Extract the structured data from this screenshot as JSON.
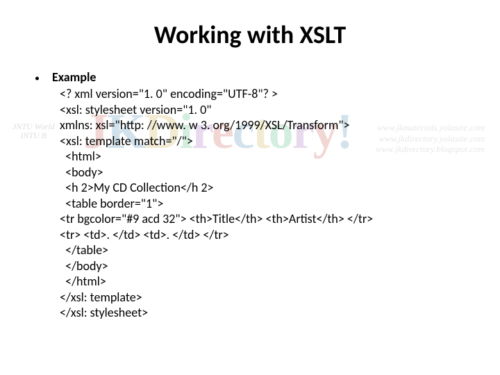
{
  "title": "Working with XSLT",
  "bullet_label": "Example",
  "code": {
    "l1": "<? xml version=\"1. 0\" encoding=\"UTF-8\"? >",
    "l2": "<xsl: stylesheet version=\"1. 0\"",
    "l3": "xmlns: xsl=\"http: //www. w 3. org/1999/XSL/Transform\">",
    "l4": "<xsl: template match=\"/\">",
    "l5": "  <html>",
    "l6": "  <body>",
    "l7": "  <h 2>My CD Collection</h 2>",
    "l8": "  <table border=\"1\">",
    "l9": "    <tr bgcolor=\"#9 acd 32\">       <th>Title</th>       <th>Artist</th>     </tr>",
    "l10": "    <tr>          <td>. </td>        <td>. </td>      </tr>",
    "l11": "  </table>",
    "l12": "  </body>",
    "l13": "  </html>",
    "l14": "</xsl: template>",
    "l15": "</xsl: stylesheet>"
  },
  "watermark": {
    "left_line1": "JNTU World",
    "left_line2": "INTU B",
    "big": "JKDirectory!",
    "right1": "www.jkmaterials.yolasite.com",
    "right2": "www.jkdirectory.yolasite.com",
    "right3": "www.jkdirectory.blogspot.com"
  }
}
